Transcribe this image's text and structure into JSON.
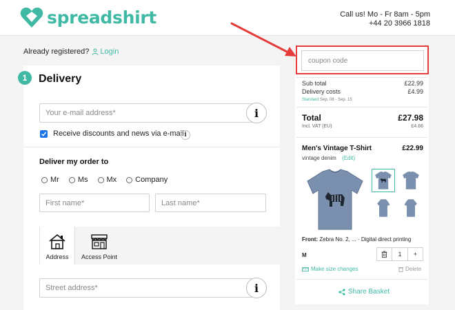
{
  "brand": {
    "name": "spreadshirt",
    "color": "#3fb9a3"
  },
  "header": {
    "contact_line1": "Call us! Mo - Fr 8am - 5pm",
    "contact_line2": "+44 20 3966 1818"
  },
  "account": {
    "prompt": "Already registered?",
    "login_label": "Login"
  },
  "delivery": {
    "step": "1",
    "title": "Delivery",
    "email_placeholder": "Your e-mail address*",
    "info_label": "i",
    "newsletter_label": "Receive discounts and news via e-mail",
    "newsletter_checked": true,
    "order_to_label": "Deliver my order to",
    "salutations": [
      "Mr",
      "Ms",
      "Mx",
      "Company"
    ],
    "first_name_placeholder": "First name*",
    "last_name_placeholder": "Last name*",
    "methods": [
      {
        "label": "Address",
        "icon": "house-icon",
        "active": true
      },
      {
        "label": "Access Point",
        "icon": "shop-icon",
        "active": false
      }
    ],
    "street_placeholder": "Street address*"
  },
  "summary": {
    "coupon_placeholder": "coupon code",
    "subtotal_label": "Sub total",
    "subtotal_value": "£22.99",
    "delivery_label": "Delivery costs",
    "delivery_value": "£4.99",
    "standard_label": "Standard",
    "standard_dates": "Sep. 08 - Sep. 15",
    "total_label": "Total",
    "total_value": "£27.98",
    "vat_label": "Incl. VAT (EU)",
    "vat_value": "£4.66",
    "product": {
      "name": "Men's Vintage T-Shirt",
      "price": "£22.99",
      "variant": "vintage denim",
      "edit_label": "(Edit)",
      "front_label": "Front:",
      "front_value": "Zebra No. 2, ...",
      "print_method": "· Digital direct printing",
      "size": "M",
      "quantity": "1",
      "size_change_label": "Make size changes",
      "delete_label": "Delete",
      "shirt_color": "#7a90ae"
    },
    "share_label": "Share Basket"
  },
  "annotation": {
    "color": "#e53b3b"
  }
}
